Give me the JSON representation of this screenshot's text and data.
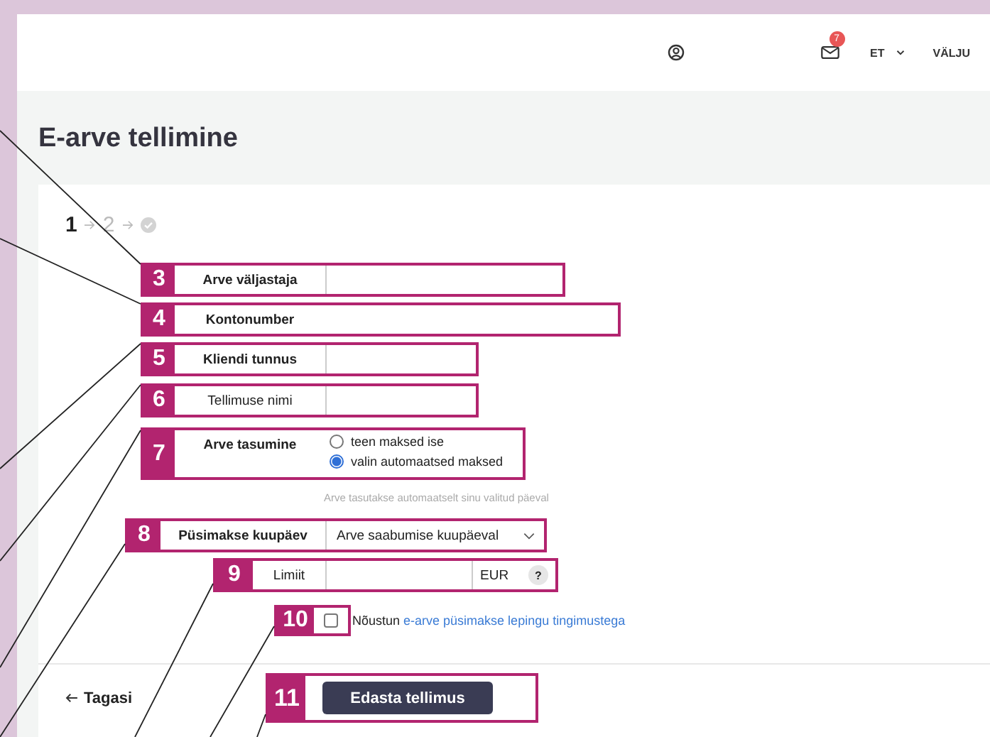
{
  "header": {
    "notification_count": "7",
    "language": "ET",
    "logout": "VÄLJU"
  },
  "page_title": "E-arve tellimine",
  "steps": [
    {
      "kind": "number",
      "label": "1",
      "selected": true
    },
    {
      "kind": "number",
      "label": "2",
      "selected": false
    },
    {
      "kind": "done",
      "selected": false
    }
  ],
  "form": {
    "fields": [
      {
        "callout": "3",
        "kind": "text",
        "label": "Arve väljastaja",
        "bold": true
      },
      {
        "callout": "4",
        "kind": "plain",
        "label": "Kontonumber",
        "bold": true
      },
      {
        "callout": "5",
        "kind": "text",
        "label": "Kliendi tunnus",
        "bold": true
      },
      {
        "callout": "6",
        "kind": "text",
        "label": "Tellimuse nimi",
        "bold": false
      },
      {
        "callout": "7",
        "kind": "radio",
        "label": "Arve tasumine",
        "bold": true,
        "options": [
          {
            "label": "teen maksed ise",
            "selected": false
          },
          {
            "label": "valin automaatsed maksed",
            "selected": true
          }
        ],
        "hint": "Arve tasutakse automaatselt sinu valitud päeval"
      },
      {
        "callout": "8",
        "kind": "select",
        "label": "Püsimakse kuupäev",
        "bold": true,
        "value": "Arve saabumise kuupäeval"
      },
      {
        "callout": "9",
        "kind": "amount",
        "label": "Limiit",
        "bold": false,
        "unit": "EUR",
        "help": "?"
      },
      {
        "callout": "10",
        "kind": "checkbox",
        "checked": false,
        "text": "Nõustun",
        "link": "e-arve püsimakse lepingu tingimustega"
      }
    ]
  },
  "footer": {
    "back": "Tagasi",
    "submit_callout": "11",
    "submit": "Edasta tellimus"
  }
}
